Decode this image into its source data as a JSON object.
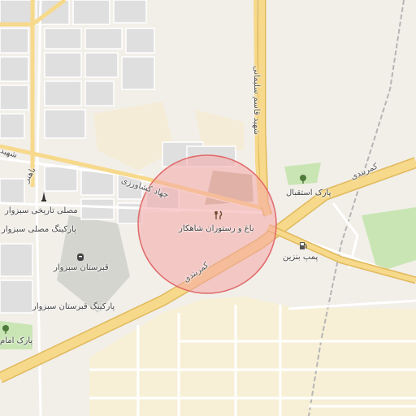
{
  "labels": {
    "restaurant": "باغ و رستوران شاهکار",
    "jahad_road": "جهاد کشاورزی",
    "ghasem_road": "شهید قاسم سلیمانی",
    "kamarbandi_top": "کمربندی",
    "kamarbandi_bottom": "کمربندی",
    "park_esteghbal": "پارک استقبال",
    "gas_station": "پمپ بنزین",
    "mosalla": "مصلی تاریخی سبزوار",
    "parking_mosalla": "پارکینگ مصلی سبزوار",
    "cemetery": "قبرستان سبزوار",
    "parking_cemetery": "پارکینگ قبرستان سبزوار",
    "park_left": "پارک امام",
    "road_shahid": "شهید",
    "road_bahonar": "باهنر"
  },
  "icons": {
    "restaurant": "fork-knife-icon",
    "park": "tree-icon",
    "gas": "fuel-pump-icon",
    "mosalla": "monument-icon",
    "parking": "parking-icon"
  },
  "colors": {
    "background": "#f2efe9",
    "residential": "#e0dfdf",
    "highway": "#f7d98b",
    "highway_casing": "#e0b95c",
    "circle_fill": "#f4a6a6",
    "circle_stroke": "#e06a6a",
    "park": "#c9e5b4",
    "industrial": "#f7f0d6"
  }
}
